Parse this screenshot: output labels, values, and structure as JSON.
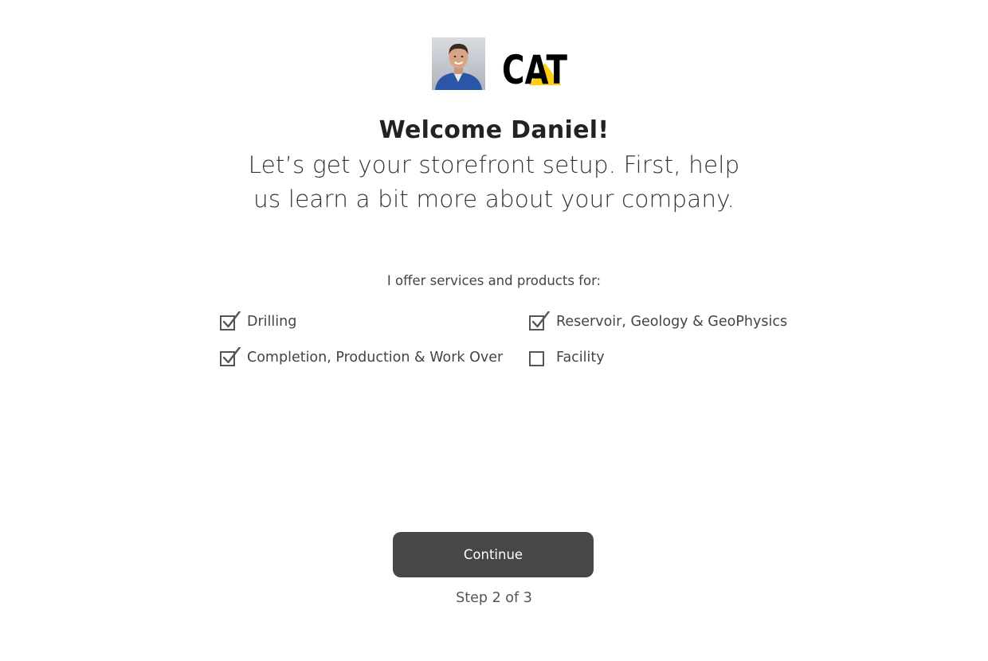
{
  "header": {
    "avatar_icon": "user-photo",
    "logo_text": "CAT",
    "logo_colors": {
      "text": "#000000",
      "triangle": "#ffcd11"
    }
  },
  "welcome": {
    "title": "Welcome Daniel!",
    "subtitle": "Let’s get your storefront setup. First, help us learn a bit more about your company."
  },
  "form": {
    "prompt": "I offer services and products for:",
    "options": [
      {
        "label": "Drilling",
        "checked": true
      },
      {
        "label": "Reservoir, Geology & GeoPhysics",
        "checked": true
      },
      {
        "label": "Completion, Production & Work Over",
        "checked": true
      },
      {
        "label": "Facility",
        "checked": false
      }
    ]
  },
  "footer": {
    "continue_label": "Continue",
    "step_text": "Step 2 of 3"
  },
  "colors": {
    "button_bg": "#474747",
    "checkbox_stroke": "#555555"
  }
}
